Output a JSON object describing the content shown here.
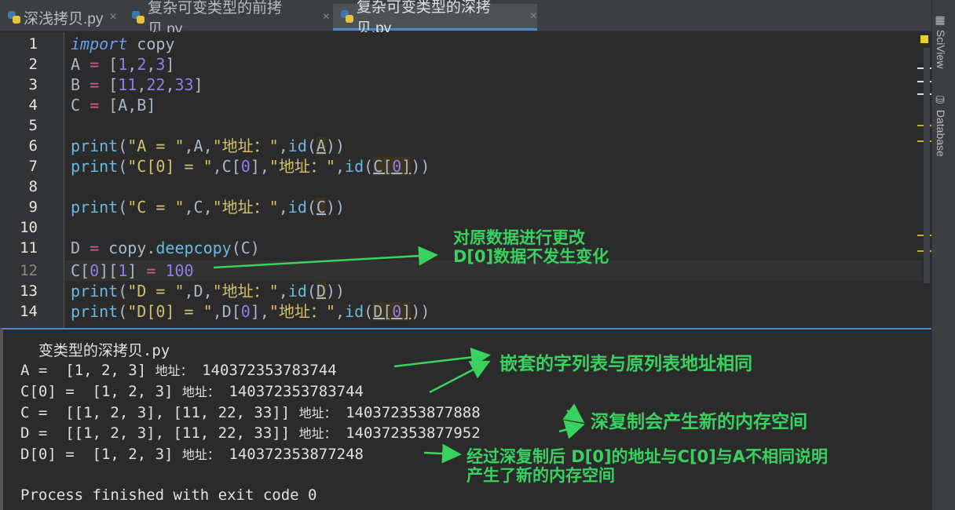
{
  "tabs": [
    {
      "label": "深浅拷贝.py",
      "active": false
    },
    {
      "label": "复杂可变类型的前拷贝.py",
      "active": false
    },
    {
      "label": "复杂可变类型的深拷贝.py",
      "active": true
    }
  ],
  "sidebar": {
    "sciview": "SciView",
    "database": "Database"
  },
  "editor": {
    "line_numbers": [
      "1",
      "2",
      "3",
      "4",
      "5",
      "6",
      "7",
      "8",
      "9",
      "10",
      "11",
      "12",
      "13",
      "14"
    ],
    "caret_line": "12"
  },
  "annotations": {
    "editor_note_line1": "对原数据进行更改",
    "editor_note_line2": "D[0]数据不发生变化",
    "console_note1": "嵌套的字列表与原列表地址相同",
    "console_note2": "深复制会产生新的内存空间",
    "console_note3_line1": "经过深复制后 D[0]的地址与C[0]与A不相同说明",
    "console_note3_line2": "产生了新的内存空间"
  },
  "console": {
    "header": "  变类型的深拷贝.py",
    "label_addr": "地址：",
    "rows": [
      {
        "prefix": "A =  [1, 2, 3] ",
        "addr": "140372353783744"
      },
      {
        "prefix": "C[0] =  [1, 2, 3] ",
        "addr": "140372353783744"
      },
      {
        "prefix": "C =  [[1, 2, 3], [11, 22, 33]] ",
        "addr": "140372353877888"
      },
      {
        "prefix": "D =  [[1, 2, 3], [11, 22, 33]] ",
        "addr": "140372353877952"
      },
      {
        "prefix": "D[0] =  [1, 2, 3] ",
        "addr": "140372353877248"
      }
    ],
    "exit": "Process finished with exit code 0"
  },
  "colors": {
    "annotation": "#39d160",
    "keyword": "#6c9ee8",
    "number": "#8f7ee8",
    "operator": "#cc5c8c"
  }
}
